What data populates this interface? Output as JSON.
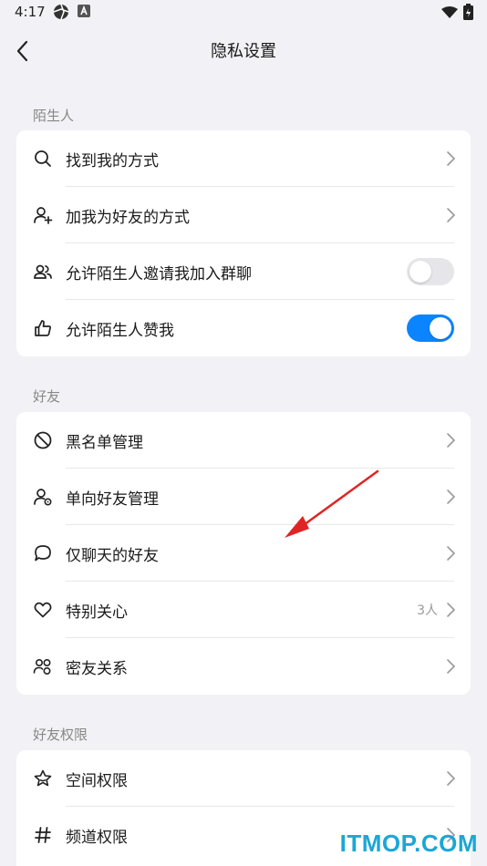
{
  "status_bar": {
    "time": "4:17"
  },
  "header": {
    "title": "隐私设置"
  },
  "sections": [
    {
      "label": "陌生人",
      "items": [
        {
          "label": "找到我的方式",
          "icon": "search-icon",
          "control": "chevron"
        },
        {
          "label": "加我为好友的方式",
          "icon": "add-user-icon",
          "control": "chevron"
        },
        {
          "label": "允许陌生人邀请我加入群聊",
          "icon": "group-icon",
          "control": "toggle",
          "toggle_on": false
        },
        {
          "label": "允许陌生人赞我",
          "icon": "thumbs-up-icon",
          "control": "toggle",
          "toggle_on": true
        }
      ]
    },
    {
      "label": "好友",
      "items": [
        {
          "label": "黑名单管理",
          "icon": "block-icon",
          "control": "chevron"
        },
        {
          "label": "单向好友管理",
          "icon": "one-way-friend-icon",
          "control": "chevron"
        },
        {
          "label": "仅聊天的好友",
          "icon": "chat-bubble-icon",
          "control": "chevron"
        },
        {
          "label": "特别关心",
          "icon": "heart-icon",
          "control": "chevron",
          "value": "3人"
        },
        {
          "label": "密友关系",
          "icon": "close-friends-icon",
          "control": "chevron"
        }
      ]
    },
    {
      "label": "好友权限",
      "items": [
        {
          "label": "空间权限",
          "icon": "star-icon",
          "control": "chevron"
        },
        {
          "label": "频道权限",
          "icon": "hashtag-icon",
          "control": "chevron"
        }
      ]
    }
  ],
  "colors": {
    "accent": "#0a84ff",
    "annotation": "#e02424",
    "watermark": "#1ba7d6"
  },
  "watermark": "ITMOP.COM"
}
